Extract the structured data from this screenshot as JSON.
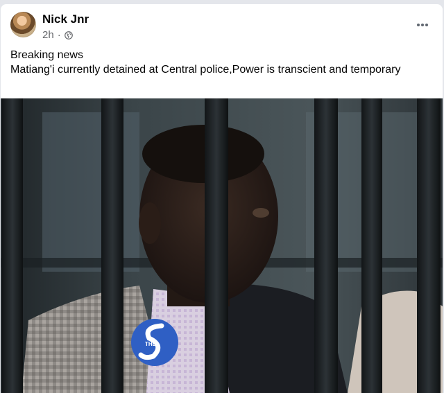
{
  "post": {
    "author": "Nick Jnr",
    "time": "2h",
    "separator": "·",
    "privacy_icon": "globe-icon",
    "more_icon": "more-horizontal-icon",
    "lines": [
      "Breaking news",
      "Matiang'i currently detained at Central police,Power is transcient and temporary"
    ]
  },
  "photo": {
    "watermark_text": "THE"
  },
  "colors": {
    "name": "#050505",
    "secondary": "#65676b",
    "watermark_blue": "#2f5fc4"
  }
}
